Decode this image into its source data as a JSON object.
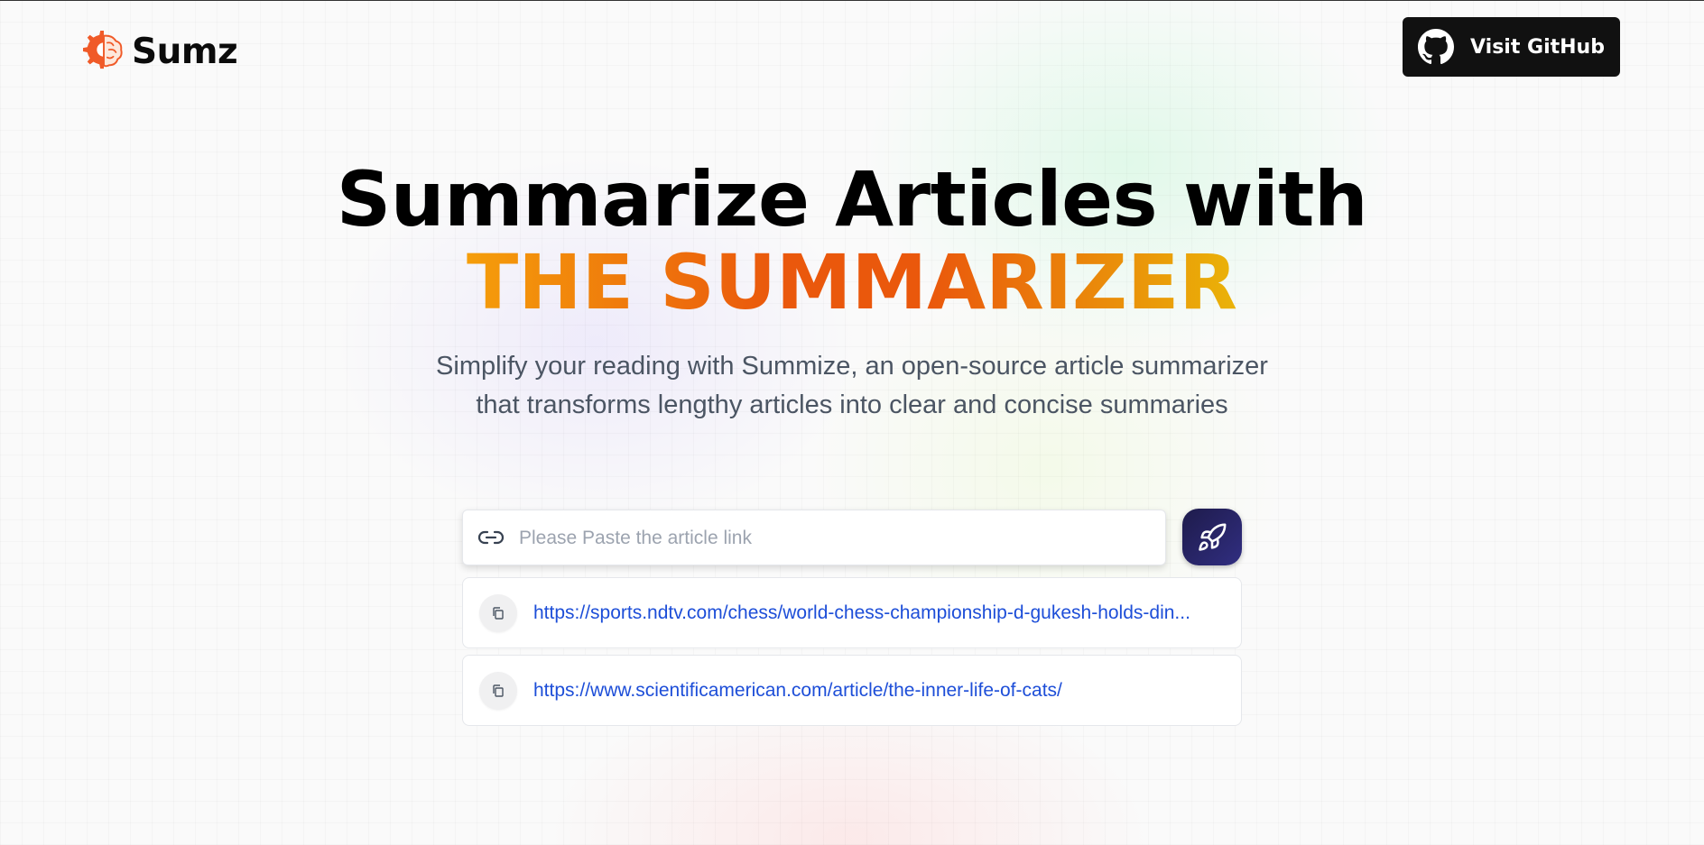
{
  "brand": {
    "name": "Sumz"
  },
  "nav": {
    "github_label": "Visit GitHub"
  },
  "hero": {
    "title_line1": "Summarize Articles with",
    "title_line2": "THE SUMMARIZER",
    "description_line1": "Simplify your reading with Summize, an open-source article summarizer",
    "description_line2": "that transforms lengthy articles into clear and concise summaries"
  },
  "search": {
    "placeholder": "Please Paste the article link",
    "value": ""
  },
  "history": [
    {
      "url": "https://sports.ndtv.com/chess/world-chess-championship-d-gukesh-holds-din..."
    },
    {
      "url": "https://www.scientificamerican.com/article/the-inner-life-of-cats/"
    }
  ],
  "colors": {
    "accent_gradient_start": "#f59e0b",
    "accent_gradient_mid": "#ea580c",
    "accent_gradient_end": "#eab308",
    "submit_bg": "#1e1b4b",
    "link": "#1d4ed8",
    "github_btn_bg": "#111111"
  },
  "icons": {
    "logo": "brain-gear-icon",
    "github": "github-icon",
    "link": "link-icon",
    "submit": "rocket-icon",
    "copy": "copy-icon"
  }
}
